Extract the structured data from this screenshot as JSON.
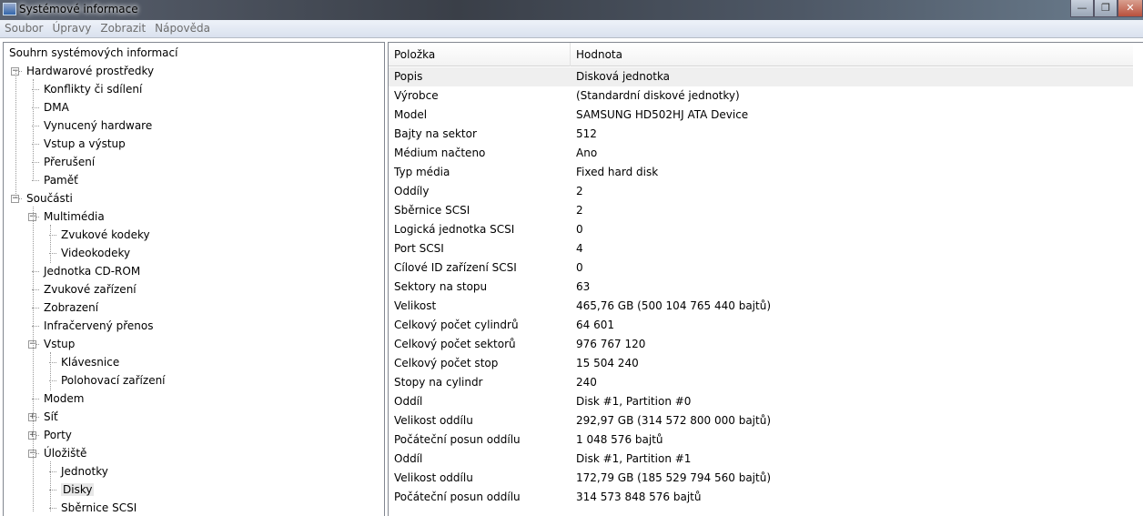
{
  "window": {
    "title": "Systémové informace",
    "minimize": "—",
    "restore": "❐",
    "close": "✕"
  },
  "menu": [
    "Soubor",
    "Úpravy",
    "Zobrazit",
    "Nápověda"
  ],
  "tree": [
    {
      "label": "Souhrn systémových informací",
      "level": 0
    },
    {
      "label": "Hardwarové prostředky",
      "level": 1,
      "exp": "−"
    },
    {
      "label": "Konflikty či sdílení",
      "level": 2
    },
    {
      "label": "DMA",
      "level": 2
    },
    {
      "label": "Vynucený hardware",
      "level": 2
    },
    {
      "label": "Vstup a výstup",
      "level": 2
    },
    {
      "label": "Přerušení",
      "level": 2
    },
    {
      "label": "Paměť",
      "level": 2
    },
    {
      "label": "Součásti",
      "level": 1,
      "exp": "−"
    },
    {
      "label": "Multimédia",
      "level": 2,
      "exp": "−"
    },
    {
      "label": "Zvukové kodeky",
      "level": 3
    },
    {
      "label": "Videokodeky",
      "level": 3
    },
    {
      "label": "Jednotka CD-ROM",
      "level": 2
    },
    {
      "label": "Zvukové zařízení",
      "level": 2
    },
    {
      "label": "Zobrazení",
      "level": 2
    },
    {
      "label": "Infračervený přenos",
      "level": 2
    },
    {
      "label": "Vstup",
      "level": 2,
      "exp": "−"
    },
    {
      "label": "Klávesnice",
      "level": 3
    },
    {
      "label": "Polohovací zařízení",
      "level": 3
    },
    {
      "label": "Modem",
      "level": 2
    },
    {
      "label": "Síť",
      "level": 2,
      "exp": "+"
    },
    {
      "label": "Porty",
      "level": 2,
      "exp": "+"
    },
    {
      "label": "Úložiště",
      "level": 2,
      "exp": "−"
    },
    {
      "label": "Jednotky",
      "level": 3
    },
    {
      "label": "Disky",
      "level": 3,
      "selected": true
    },
    {
      "label": "Sběrnice SCSI",
      "level": 3
    }
  ],
  "table": {
    "headers": [
      "Položka",
      "Hodnota"
    ],
    "rows": [
      [
        "Popis",
        "Disková jednotka"
      ],
      [
        "Výrobce",
        "(Standardní diskové jednotky)"
      ],
      [
        "Model",
        "SAMSUNG HD502HJ ATA Device"
      ],
      [
        "Bajty na sektor",
        "512"
      ],
      [
        "Médium načteno",
        "Ano"
      ],
      [
        "Typ média",
        "Fixed hard disk"
      ],
      [
        "Oddíly",
        "2"
      ],
      [
        "Sběrnice SCSI",
        "2"
      ],
      [
        "Logická jednotka SCSI",
        "0"
      ],
      [
        "Port SCSI",
        "4"
      ],
      [
        "Cílové ID zařízení SCSI",
        "0"
      ],
      [
        "Sektory na stopu",
        "63"
      ],
      [
        "Velikost",
        "465,76 GB (500 104 765 440 bajtů)"
      ],
      [
        "Celkový počet cylindrů",
        "64 601"
      ],
      [
        "Celkový počet sektorů",
        "976 767 120"
      ],
      [
        "Celkový počet stop",
        "15 504 240"
      ],
      [
        "Stopy na cylindr",
        "240"
      ],
      [
        "Oddíl",
        "Disk #1, Partition #0"
      ],
      [
        "Velikost oddílu",
        "292,97 GB (314 572 800 000 bajtů)"
      ],
      [
        "Počáteční posun oddílu",
        "1 048 576 bajtů"
      ],
      [
        "Oddíl",
        "Disk #1, Partition #1"
      ],
      [
        "Velikost oddílu",
        "172,79 GB (185 529 794 560 bajtů)"
      ],
      [
        "Počáteční posun oddílu",
        "314 573 848 576 bajtů"
      ]
    ]
  }
}
